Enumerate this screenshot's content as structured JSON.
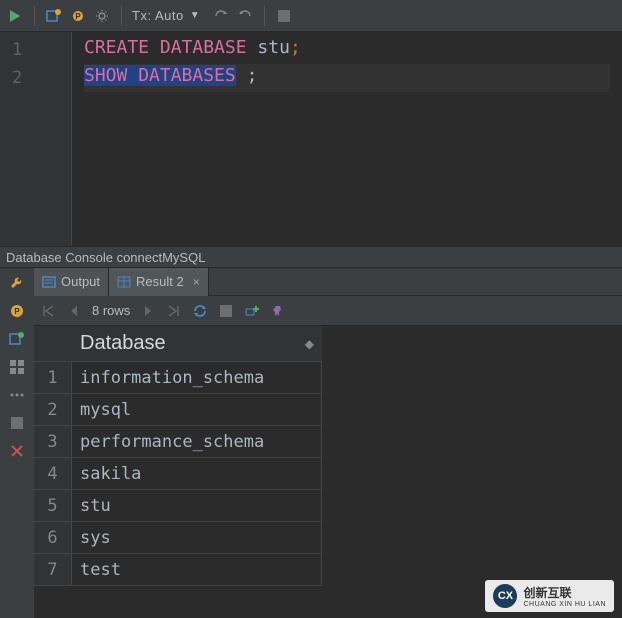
{
  "toolbar": {
    "tx_label": "Tx: Auto",
    "tx_dropdown": "▼"
  },
  "editor": {
    "lines": [
      {
        "n": "1",
        "tokens": [
          {
            "t": "CREATE",
            "c": "kw-pink"
          },
          {
            "t": " ",
            "c": ""
          },
          {
            "t": "DATABASE",
            "c": "kw-pink"
          },
          {
            "t": " ",
            "c": ""
          },
          {
            "t": "stu",
            "c": "ident"
          },
          {
            "t": ";",
            "c": "semi"
          }
        ]
      },
      {
        "n": "2",
        "tokens": [
          {
            "t": "SHOW",
            "c": "kw-pink"
          },
          {
            "t": " ",
            "c": ""
          },
          {
            "t": "DATABASES",
            "c": "kw-pink"
          },
          {
            "t": " ",
            "c": ""
          },
          {
            "t": ";",
            "c": "semi"
          }
        ],
        "current": true
      }
    ]
  },
  "panel_title": "Database Console connectMySQL",
  "tabs": {
    "output": "Output",
    "result": "Result 2"
  },
  "result_toolbar": {
    "row_count": "8 rows"
  },
  "grid": {
    "column": "Database",
    "rows": [
      "information_schema",
      "mysql",
      "performance_schema",
      "sakila",
      "stu",
      "sys",
      "test"
    ]
  },
  "watermark": {
    "logo": "CX",
    "line1": "创新互联",
    "line2": "CHUANG XIN HU LIAN"
  }
}
